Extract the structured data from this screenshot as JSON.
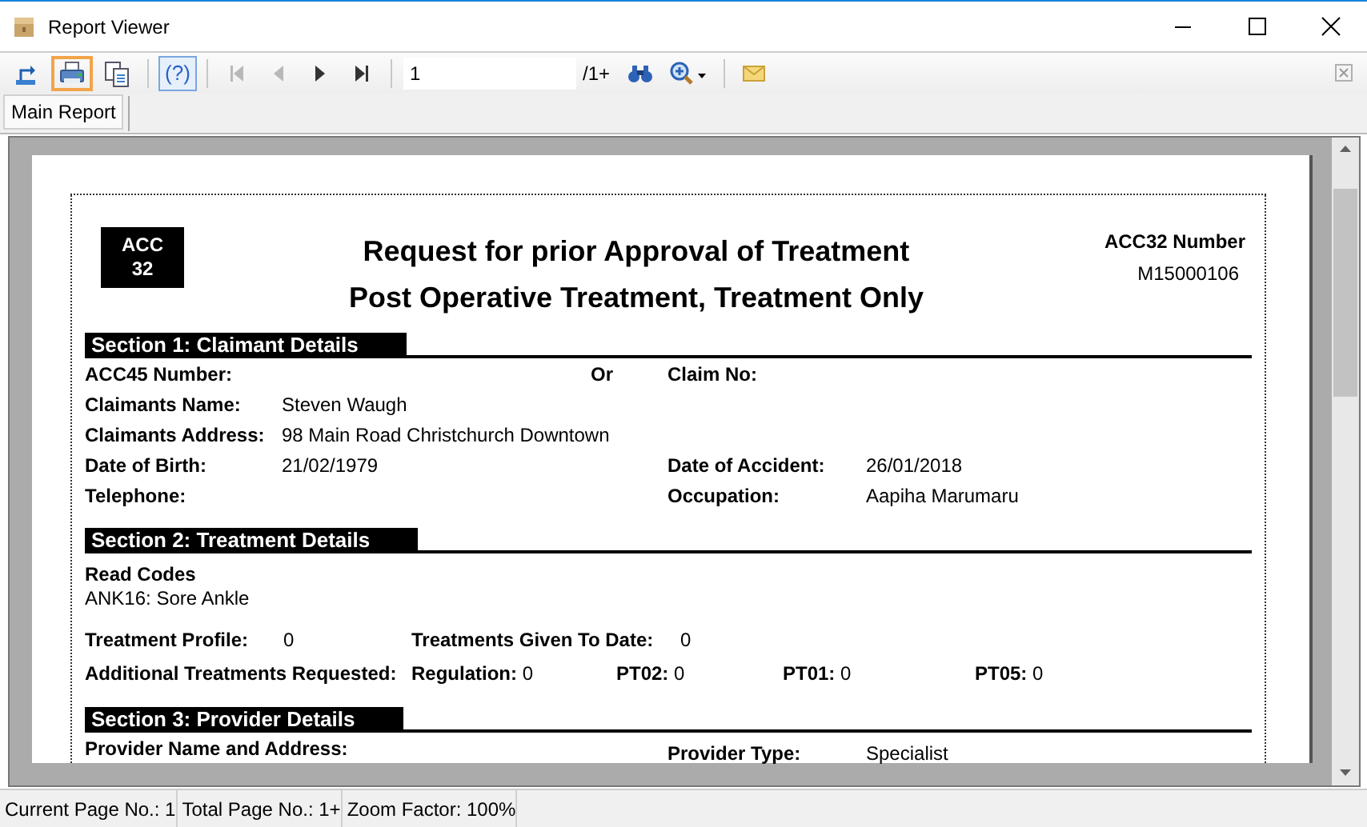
{
  "window": {
    "title": "Report Viewer"
  },
  "toolbar": {
    "buttons": [
      {
        "kind": "export",
        "selected": false
      },
      {
        "kind": "print",
        "selected": true
      },
      {
        "kind": "copy",
        "selected": false
      }
    ],
    "help": {
      "label": "(?)"
    },
    "nav": [
      {
        "kind": "first",
        "disabled": true
      },
      {
        "kind": "prev",
        "disabled": true
      },
      {
        "kind": "next",
        "disabled": false
      },
      {
        "kind": "last",
        "disabled": false
      }
    ],
    "page_field": "1",
    "page_total": "/1+",
    "tools": [
      {
        "kind": "find"
      },
      {
        "kind": "zoom"
      },
      {
        "kind": "mail"
      }
    ]
  },
  "tabs": [
    {
      "label": "Main Report",
      "selected": true
    }
  ],
  "report": {
    "badge": [
      "ACC",
      "32"
    ],
    "title": "Request for prior Approval of Treatment",
    "subtitle": "Post Operative Treatment, Treatment Only",
    "number_label": "ACC32 Number",
    "number_value": "M15000106",
    "sections": [
      {
        "title": "Section 1: Claimant Details",
        "rows": [
          {
            "label": "ACC45 Number:",
            "separator": "Or",
            "right_label": "Claim No:"
          },
          {
            "label": "Claimants Name:",
            "value": "Steven Waugh"
          },
          {
            "label": "Claimants Address:",
            "value": "98 Main Road Christchurch Downtown"
          },
          {
            "label": "Date of Birth:",
            "value": "21/02/1979",
            "right_label": "Date of Accident:",
            "right_value": "26/01/2018"
          },
          {
            "label": "Telephone:",
            "right_label": "Occupation:",
            "right_value": "Aapiha Marumaru"
          }
        ]
      },
      {
        "title": "Section 2: Treatment Details",
        "read_codes_heading": "Read Codes",
        "read_code": "ANK16: Sore Ankle",
        "rows": [
          {
            "label": "Treatment Profile:",
            "value": "0",
            "right_label": "Treatments Given To Date:",
            "right_value": "0"
          }
        ],
        "additional": {
          "label": "Additional Treatments Requested:",
          "items": [
            {
              "label": "Regulation:",
              "value": "0"
            },
            {
              "label": "PT02:",
              "value": "0"
            },
            {
              "label": "PT01:",
              "value": "0"
            },
            {
              "label": "PT05:",
              "value": "0"
            }
          ]
        }
      },
      {
        "title": "Section 3: Provider Details",
        "rows": [
          {
            "label": "Provider Name and Address:"
          },
          {
            "right_label": "Provider Type:",
            "right_value": "Specialist"
          }
        ]
      }
    ]
  },
  "status_bar": [
    "Current Page No.: 1",
    "Total Page No.: 1+",
    "Zoom Factor: 100%"
  ]
}
